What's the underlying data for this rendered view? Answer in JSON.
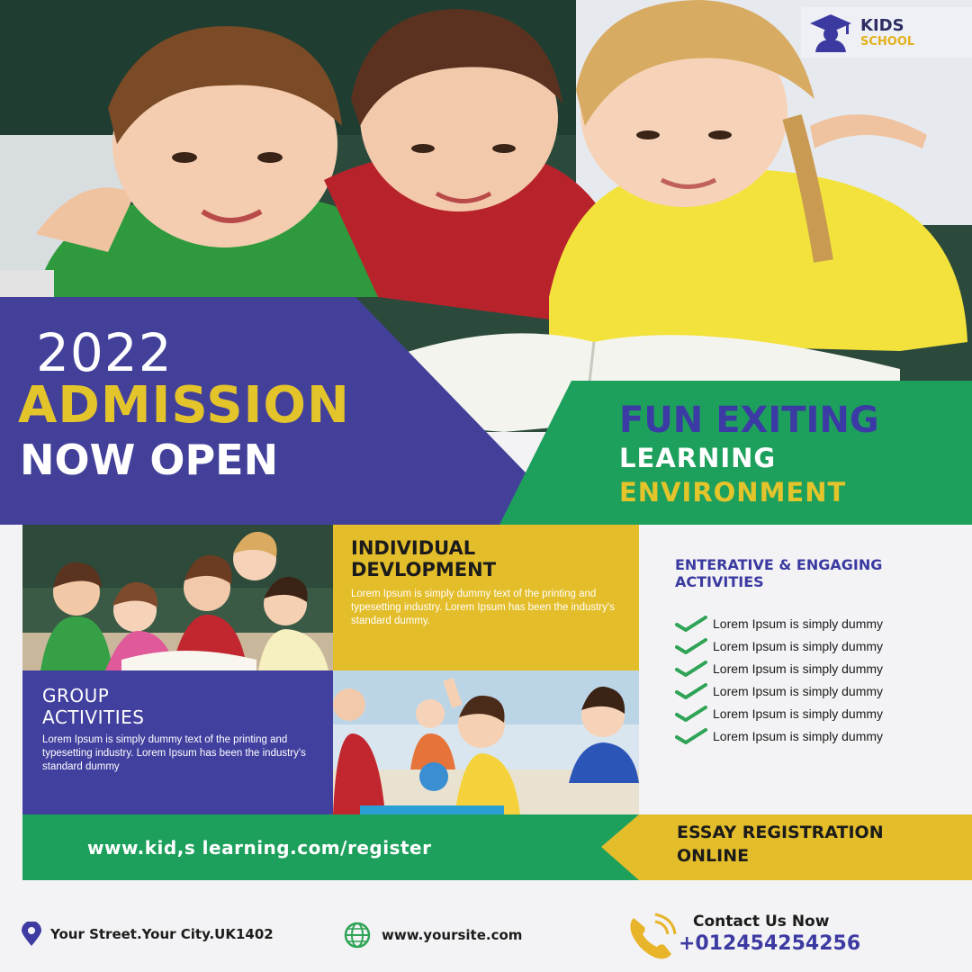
{
  "brand": {
    "line1": "KIDS",
    "line2": "SCHOOL"
  },
  "headline": {
    "year": "2022",
    "admission": "ADMISSION",
    "now_open": "NOW OPEN"
  },
  "tagline": {
    "line1": "FUN EXITING",
    "line2": "LEARNING",
    "line3": "ENVIRONMENT"
  },
  "individual": {
    "title_line1": "INDIVIDUAL",
    "title_line2": "DEVLOPMENT",
    "body": "Lorem Ipsum is simply dummy text of the printing and typesetting industry. Lorem Ipsum has been the industry's standard dummy."
  },
  "group": {
    "title_line1": "GROUP",
    "title_line2": "ACTIVITIES",
    "body": "Lorem Ipsum is simply dummy text of the printing and typesetting industry. Lorem Ipsum has been the industry's standard dummy"
  },
  "activities": {
    "title_line1": "ENTERATIVE & ENGAGING",
    "title_line2": "ACTIVITIES",
    "items": [
      "Lorem Ipsum is simply dummy",
      "Lorem Ipsum is simply dummy",
      "Lorem Ipsum is simply dummy",
      "Lorem Ipsum is simply dummy",
      "Lorem Ipsum is simply dummy",
      "Lorem Ipsum is simply dummy"
    ]
  },
  "registration": {
    "url": "www.kid,s learning.com/register",
    "label_line1": "ESSAY REGISTRATION",
    "label_line2": "ONLINE"
  },
  "footer": {
    "address": "Your Street.Your City.UK1402",
    "website": "www.yoursite.com",
    "contact_label": "Contact Us Now",
    "phone": "+012454254256"
  },
  "icons": {
    "logo": "graduate-icon",
    "check": "check-icon",
    "location": "location-pin-icon",
    "globe": "globe-icon",
    "phone": "phone-icon"
  },
  "colors": {
    "purple": "#43409a",
    "green": "#1ea05d",
    "yellow": "#e4bd2a",
    "headline_yellow": "#e4c42b",
    "navy_text": "#3d3ba2"
  }
}
